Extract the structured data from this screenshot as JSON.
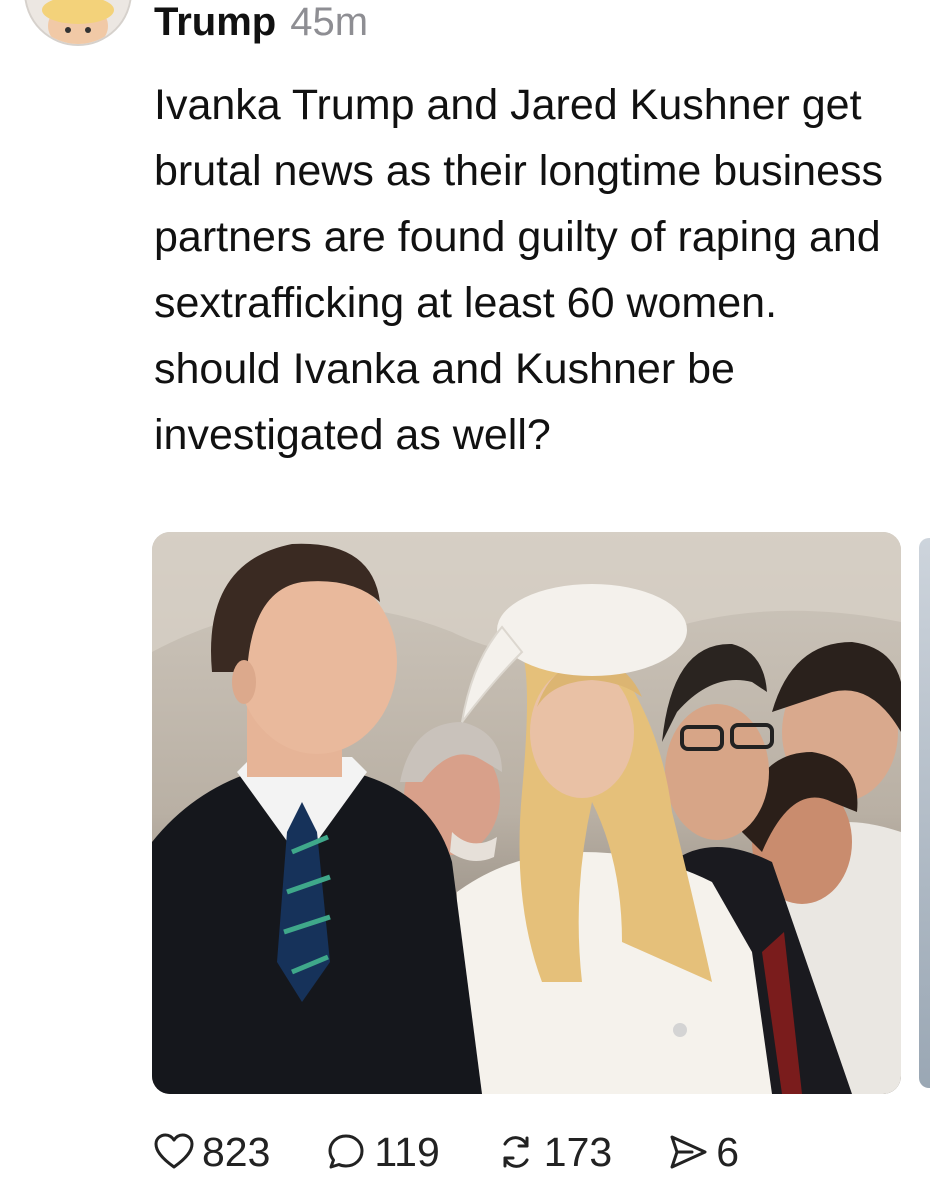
{
  "post": {
    "author": "Trump",
    "time": "45m",
    "text": "Ivanka Trump and Jared Kushner get brutal news as their longtime business partners are found guilty of raping and sextrafficking at least 60 women. should Ivanka and Kushner be investigated as well?",
    "avatar_icon": "user-avatar",
    "media": {
      "count_visible": 1,
      "has_more": true
    }
  },
  "actions": {
    "like": {
      "icon": "heart-icon",
      "count": "823"
    },
    "reply": {
      "icon": "comment-icon",
      "count": "119"
    },
    "repost": {
      "icon": "repost-icon",
      "count": "173"
    },
    "share": {
      "icon": "send-icon",
      "count": "6"
    }
  }
}
